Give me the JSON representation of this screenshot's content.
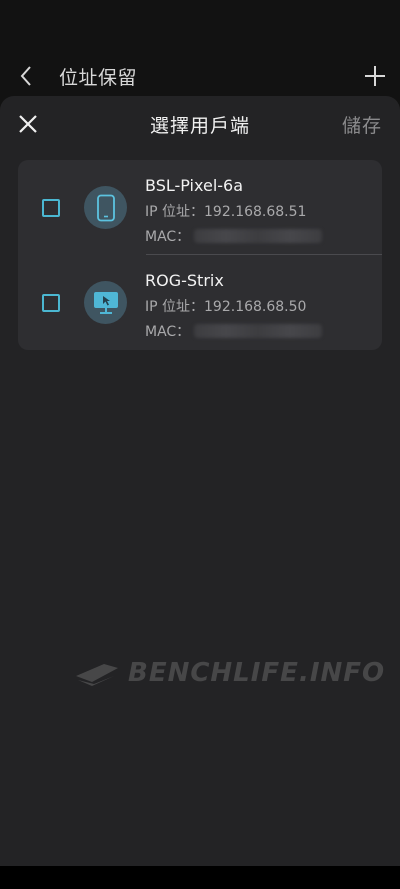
{
  "background_screen": {
    "title": "位址保留",
    "back_icon": "chevron-left-icon",
    "add_icon": "plus-icon"
  },
  "sheet": {
    "title": "選擇用戶端",
    "save_label": "儲存",
    "close_icon": "close-icon"
  },
  "devices": [
    {
      "name": "BSL-Pixel-6a",
      "ip_text": "IP 位址：192.168.68.51",
      "mac_label": "MAC：",
      "icon": "phone-icon",
      "checked": false
    },
    {
      "name": "ROG-Strix",
      "ip_text": "IP 位址：192.168.68.50",
      "mac_label": "MAC：",
      "icon": "desktop-monitor-icon",
      "checked": false
    }
  ],
  "watermark": {
    "text": "BENCHLIFE.INFO"
  },
  "colors": {
    "accent": "#4bb7d1",
    "sheet_bg": "#232325",
    "card_bg": "#2e2e31",
    "page_bg": "#121212"
  }
}
